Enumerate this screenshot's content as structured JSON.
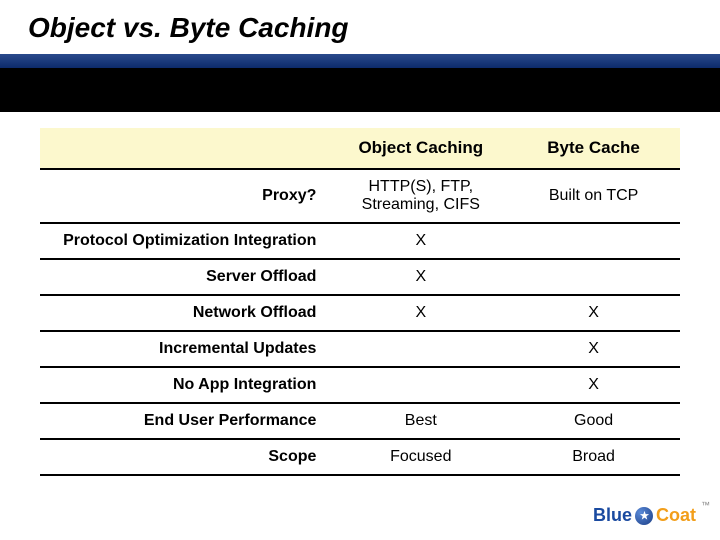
{
  "title": "Object vs. Byte Caching",
  "header": {
    "col1": "Object Caching",
    "col2": "Byte Cache"
  },
  "rows": [
    {
      "label": "Proxy?",
      "c1": "HTTP(S), FTP, Streaming, CIFS",
      "c2": "Built on TCP"
    },
    {
      "label": "Protocol Optimization Integration",
      "c1": "X",
      "c2": ""
    },
    {
      "label": "Server Offload",
      "c1": "X",
      "c2": ""
    },
    {
      "label": "Network Offload",
      "c1": "X",
      "c2": "X"
    },
    {
      "label": "Incremental Updates",
      "c1": "",
      "c2": "X"
    },
    {
      "label": "No App Integration",
      "c1": "",
      "c2": "X"
    },
    {
      "label": "End User Performance",
      "c1": "Best",
      "c2": "Good"
    },
    {
      "label": "Scope",
      "c1": "Focused",
      "c2": "Broad"
    }
  ],
  "logo": {
    "part1": "Blue",
    "part2": "Coat"
  }
}
